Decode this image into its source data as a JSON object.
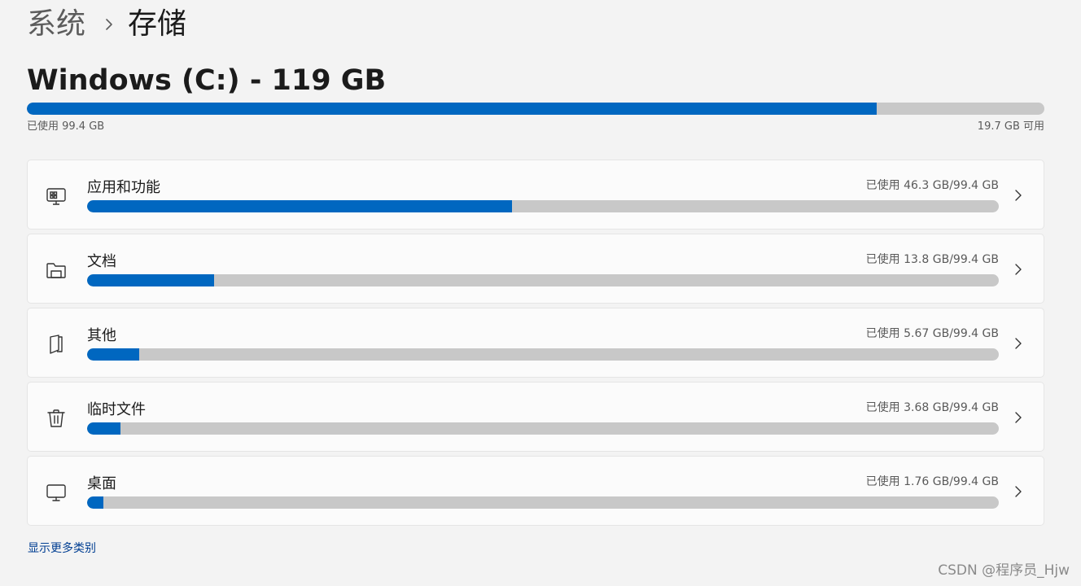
{
  "breadcrumb": {
    "parent": "系统",
    "current": "存储",
    "separator_icon": "chevron-right-icon"
  },
  "drive": {
    "title": "Windows (C:) - 119 GB",
    "used_label": "已使用 99.4 GB",
    "free_label": "19.7 GB 可用",
    "used_fraction": 0.835
  },
  "categories": [
    {
      "label": "应用和功能",
      "usage": "已使用 46.3 GB/99.4 GB",
      "fraction": 0.466,
      "icon": "apps-icon"
    },
    {
      "label": "文档",
      "usage": "已使用 13.8 GB/99.4 GB",
      "fraction": 0.139,
      "icon": "folder-icon"
    },
    {
      "label": "其他",
      "usage": "已使用 5.67 GB/99.4 GB",
      "fraction": 0.057,
      "icon": "other-files-icon"
    },
    {
      "label": "临时文件",
      "usage": "已使用 3.68 GB/99.4 GB",
      "fraction": 0.037,
      "icon": "trash-icon"
    },
    {
      "label": "桌面",
      "usage": "已使用 1.76 GB/99.4 GB",
      "fraction": 0.018,
      "icon": "desktop-icon"
    }
  ],
  "more_link": "显示更多类别",
  "watermark": "CSDN @程序员_Hjw",
  "colors": {
    "accent": "#0067c0",
    "track": "#c8c8c8",
    "link": "#003e92"
  }
}
